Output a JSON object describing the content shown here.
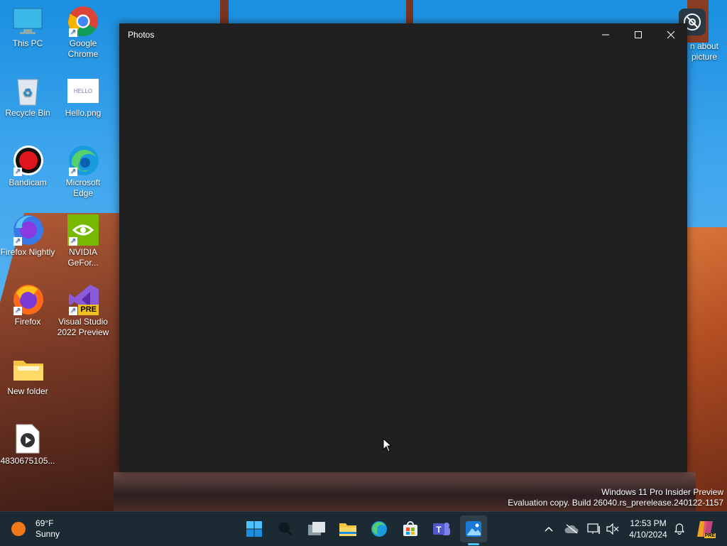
{
  "desktop": {
    "icons": [
      {
        "label": "This PC"
      },
      {
        "label": "Google Chrome"
      },
      {
        "label": "Recycle Bin"
      },
      {
        "label": "Hello.png"
      },
      {
        "label": "Bandicam"
      },
      {
        "label": "Microsoft Edge"
      },
      {
        "label": "Firefox Nightly"
      },
      {
        "label": "NVIDIA GeFor..."
      },
      {
        "label": "Firefox"
      },
      {
        "label": "Visual Studio 2022 Preview"
      },
      {
        "label": "New folder"
      },
      {
        "label": "4830675105..."
      }
    ],
    "learn_about_picture": "n about\npicture",
    "vs_badge": "PRE",
    "hello_thumb_text": "HELLO"
  },
  "window": {
    "title": "Photos"
  },
  "watermark": {
    "line1": "Windows 11 Pro Insider Preview",
    "line2": "Evaluation copy. Build 26040.rs_prerelease.240122-1157"
  },
  "taskbar": {
    "weather_temp": "69°F",
    "weather_desc": "Sunny",
    "clock_time": "12:53 PM",
    "clock_date": "4/10/2024",
    "copilot_badge": "PRE"
  },
  "colors": {
    "window_bg": "#202020",
    "taskbar_bg": "#1c2b33",
    "accent": "#0078d4"
  }
}
